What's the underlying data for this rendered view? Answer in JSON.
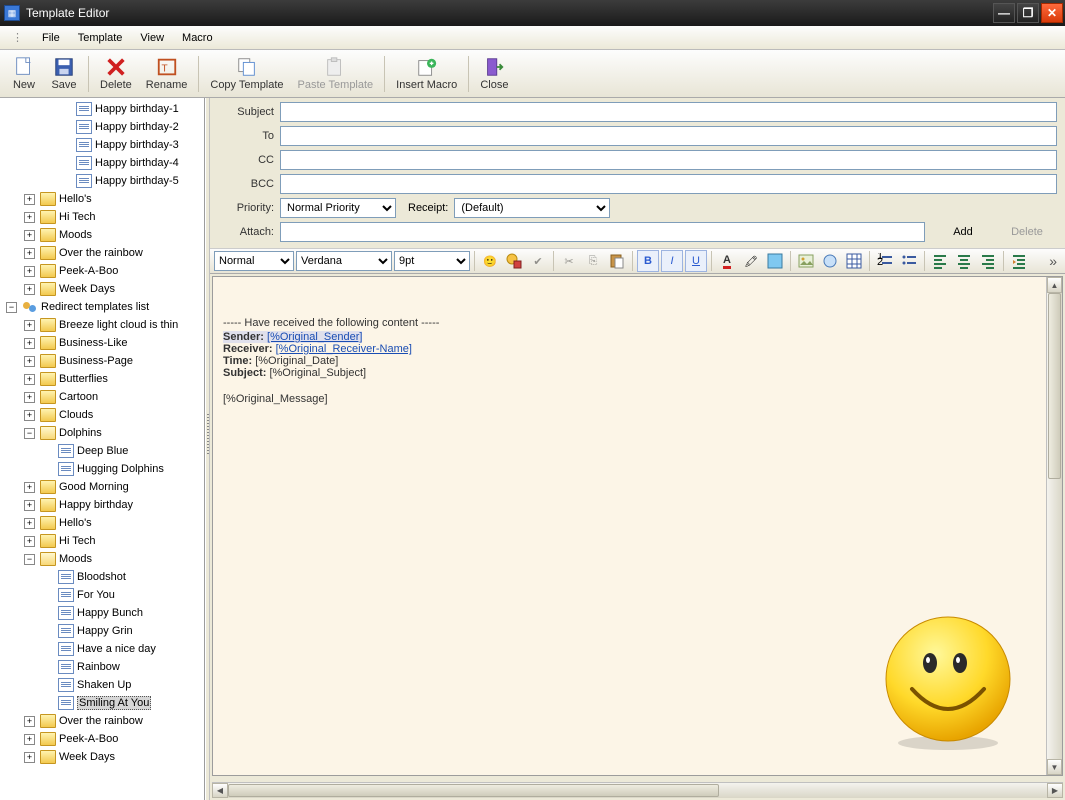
{
  "window": {
    "title": "Template Editor"
  },
  "menu": {
    "items": [
      "File",
      "Template",
      "View",
      "Macro"
    ]
  },
  "toolbar": {
    "new": "New",
    "save": "Save",
    "delete": "Delete",
    "rename": "Rename",
    "copy_template": "Copy Template",
    "paste_template": "Paste Template",
    "insert_macro": "Insert Macro",
    "close": "Close"
  },
  "tree": {
    "birthday_children": [
      "Happy birthday-1",
      "Happy birthday-2",
      "Happy birthday-3",
      "Happy birthday-4",
      "Happy birthday-5"
    ],
    "group1": [
      "Hello's",
      "Hi Tech",
      "Moods",
      "Over the rainbow",
      "Peek-A-Boo",
      "Week Days"
    ],
    "redirect_label": "Redirect templates list",
    "redirect_folders_top": [
      "Breeze light cloud is thin",
      "Business-Like",
      "Business-Page",
      "Butterflies",
      "Cartoon",
      "Clouds"
    ],
    "dolphins": {
      "label": "Dolphins",
      "children": [
        "Deep Blue",
        "Hugging Dolphins"
      ]
    },
    "redirect_mid": [
      "Good Morning",
      "Happy birthday",
      "Hello's",
      "Hi Tech"
    ],
    "moods": {
      "label": "Moods",
      "children": [
        "Bloodshot",
        "For You",
        "Happy Bunch",
        "Happy Grin",
        "Have a nice day",
        "Rainbow",
        "Shaken Up",
        "Smiling At You"
      ],
      "selected": "Smiling At You"
    },
    "redirect_tail": [
      "Over the rainbow",
      "Peek-A-Boo",
      "Week Days"
    ]
  },
  "fields": {
    "subject_label": "Subject",
    "subject_value": "",
    "to_label": "To",
    "to_value": "",
    "cc_label": "CC",
    "cc_value": "",
    "bcc_label": "BCC",
    "bcc_value": "",
    "priority_label": "Priority:",
    "priority_value": "Normal Priority",
    "receipt_label": "Receipt:",
    "receipt_value": "(Default)",
    "attach_label": "Attach:",
    "attach_value": "",
    "add_btn": "Add",
    "delete_btn": "Delete"
  },
  "editbar": {
    "style": "Normal",
    "font": "Verdana",
    "size": "9pt"
  },
  "body": {
    "header": "----- Have received the following content -----",
    "sender_label": "Sender:",
    "sender_macro": "[%Original_Sender]",
    "receiver_label": "Receiver:",
    "receiver_macro": "[%Original_Receiver-Name]",
    "time_label": "Time:",
    "time_macro": "[%Original_Date]",
    "subject_label": "Subject:",
    "subject_macro": "[%Original_Subject]",
    "message_macro": "[%Original_Message]"
  }
}
